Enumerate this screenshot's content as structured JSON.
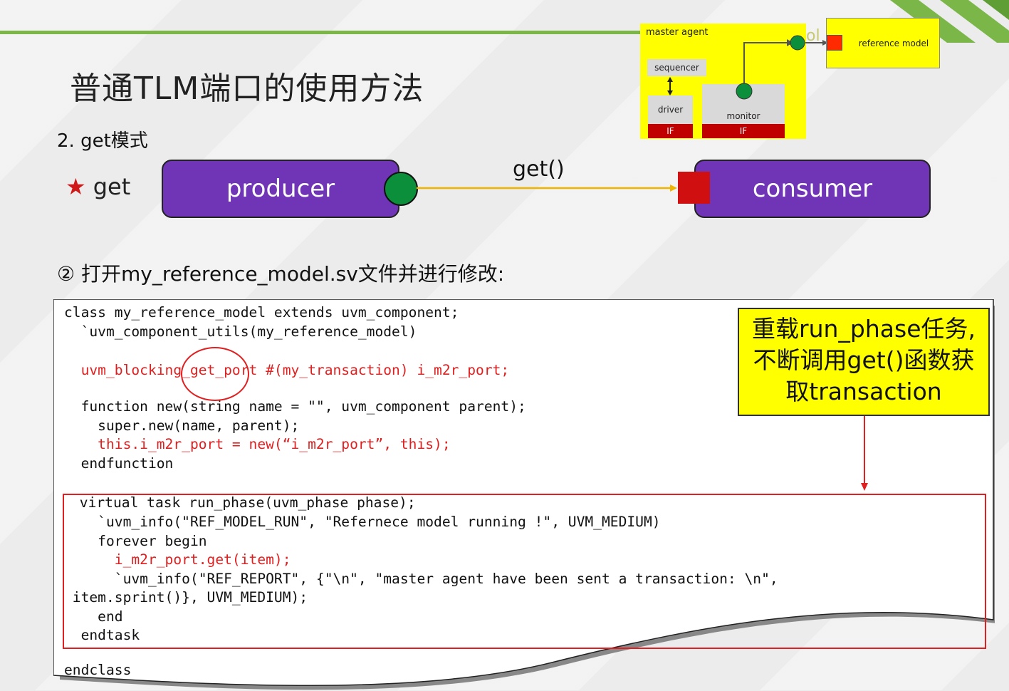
{
  "slide": {
    "title": "普通TLM端口的使用方法",
    "subtitle": "2. get模式",
    "star_label": "get",
    "producer_label": "producer",
    "consumer_label": "consumer",
    "method_label": "get()",
    "step_text": "② 打开my_reference_model.sv文件并进行修改:",
    "accent_color": "#7ab648",
    "box_color": "#6f35b6"
  },
  "mini_diagram": {
    "agent_title": "master agent",
    "sequencer": "sequencer",
    "driver": "driver",
    "monitor": "monitor",
    "if1": "IF",
    "if2": "IF",
    "reference_model": "reference model"
  },
  "callout": {
    "line1": "重载run_phase任务,",
    "line2": "不断调用get()函数获",
    "line3": "取transaction"
  },
  "code_lines": [
    "class my_reference_model extends uvm_component;",
    "  `uvm_component_utils(my_reference_model)",
    "",
    "  uvm_blocking_get_port #(my_transaction) i_m2r_port;",
    "",
    "  function new(string name = \"\", uvm_component parent);",
    "    super.new(name, parent);",
    "    this.i_m2r_port = new(“i_m2r_port”, this);",
    "  endfunction",
    "",
    " virtual task run_phase(uvm_phase phase);",
    "    `uvm_info(\"REF_MODEL_RUN\", \"Refernece model running !\", UVM_MEDIUM)",
    "    forever begin",
    "      i_m2r_port.get(item);",
    "      `uvm_info(\"REF_REPORT\", {\"\\n\", \"master agent have been sent a transaction: \\n\",",
    " item.sprint()}, UVM_MEDIUM);",
    "    end",
    "  endtask",
    "",
    "endclass"
  ]
}
